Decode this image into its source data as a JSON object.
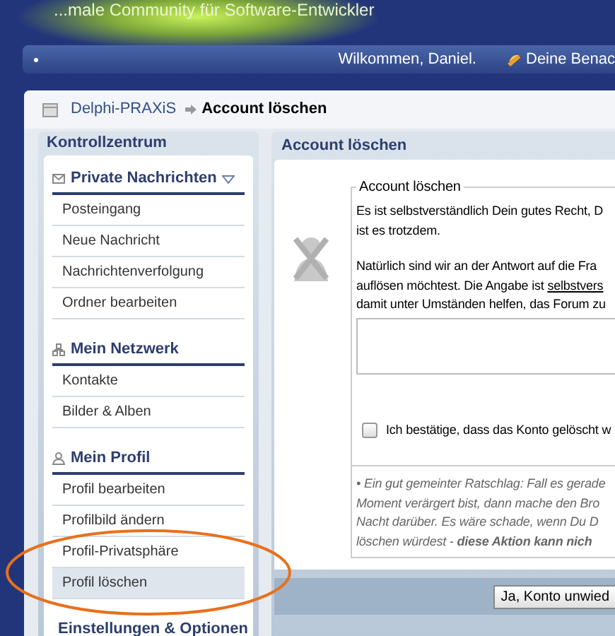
{
  "banner": {
    "tagline": "...male Community für Software-Entwickler"
  },
  "navbar": {
    "greeting": "Wilkommen, Daniel.",
    "notifications": "Deine Benac"
  },
  "breadcrumb": {
    "home": "Delphi-PRAXiS",
    "current": "Account löschen"
  },
  "sidebar": {
    "title": "Kontrollzentrum",
    "sections": [
      {
        "kind": "messages",
        "title": "Private Nachrichten",
        "expandable": true,
        "items": [
          {
            "label": "Posteingang",
            "selected": false
          },
          {
            "label": "Neue Nachricht",
            "selected": false
          },
          {
            "label": "Nachrichtenverfolgung",
            "selected": false
          },
          {
            "label": "Ordner bearbeiten",
            "selected": false
          }
        ]
      },
      {
        "kind": "network",
        "title": "Mein Netzwerk",
        "items": [
          {
            "label": "Kontakte",
            "selected": false
          },
          {
            "label": "Bilder & Alben",
            "selected": false
          }
        ]
      },
      {
        "kind": "profile",
        "title": "Mein Profil",
        "items": [
          {
            "label": "Profil bearbeiten",
            "selected": false
          },
          {
            "label": "Profilbild ändern",
            "selected": false
          },
          {
            "label": "Profil-Privatsphäre",
            "selected": false
          },
          {
            "label": "Profil löschen",
            "selected": true
          }
        ]
      },
      {
        "kind": "settings",
        "title": "Einstellungen & Optionen"
      }
    ]
  },
  "main": {
    "title": "Account löschen",
    "legend": "Account löschen",
    "intro": [
      "Es ist selbstverständlich Dein gutes Recht, D",
      "ist es trotzdem."
    ],
    "question": [
      {
        "text": "Natürlich sind wir an der Antwort auf die Fra"
      },
      {
        "text": "auflösen möchtest. Die Angabe ist ",
        "link": "selbstvers"
      },
      {
        "text": "damit unter Umständen helfen, das Forum zu"
      }
    ],
    "confirm": {
      "label": "Ich bestätige, dass das Konto gelöscht w",
      "checked": false
    },
    "advice": [
      "• Ein gut gemeinter Ratschlag: Fall es gerade",
      "Moment verärgert bist, dann mache den Bro",
      "Nacht darüber. Es wäre schade, wenn Du D",
      "löschen würdest - **diese Aktion kann nich**"
    ],
    "submit": "Ja, Konto unwied"
  }
}
